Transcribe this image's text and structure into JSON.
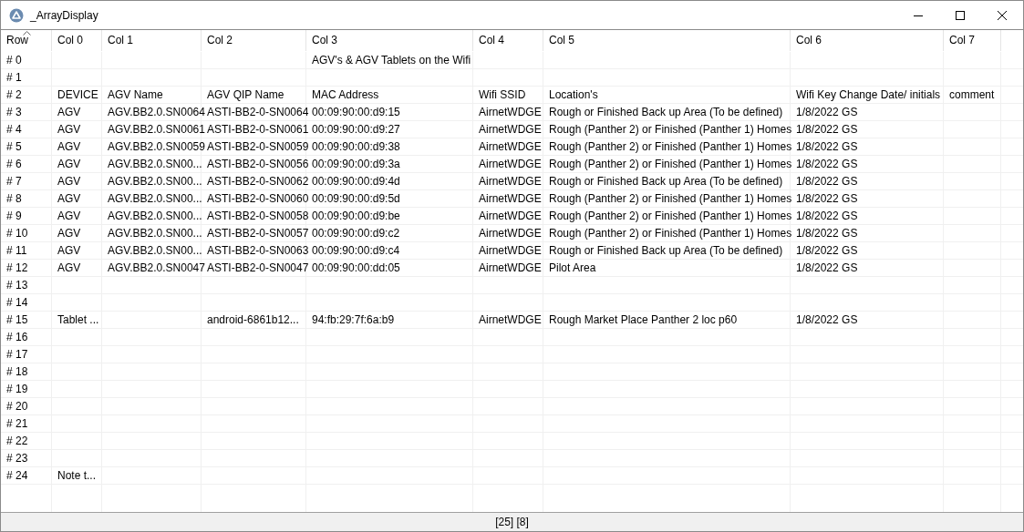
{
  "window": {
    "title": "_ArrayDisplay"
  },
  "table": {
    "row_header": "Row",
    "sorted_ascending": true,
    "columns": [
      "Col 0",
      "Col 1",
      "Col 2",
      "Col 3",
      "Col 4",
      "Col 5",
      "Col 6",
      "Col 7"
    ],
    "rows": [
      {
        "label": "# 0",
        "cells": {
          "col_3": "AGV's & AGV Tablets on the Wifi"
        }
      },
      {
        "label": "# 1",
        "cells": {}
      },
      {
        "label": "# 2",
        "cells": {
          "col_0": "DEVICE",
          "col_1": "AGV Name",
          "col_2": "AGV QIP Name",
          "col_3": "MAC Address",
          "col_4": "Wifi SSID",
          "col_5": "Location's",
          "col_6": "Wifi Key Change Date/ initials",
          "col_7": "comment"
        }
      },
      {
        "label": "# 3",
        "cells": {
          "col_0": "AGV",
          "col_1": "AGV.BB2.0.SN0064",
          "col_2": "ASTI-BB2-0-SN0064",
          "col_3": "00:09:90:00:d9:15",
          "col_4": "AirnetWDGE",
          "col_5": "Rough or Finished Back up Area (To be defined)",
          "col_6": "1/8/2022 GS"
        }
      },
      {
        "label": "# 4",
        "cells": {
          "col_0": "AGV",
          "col_1": "AGV.BB2.0.SN0061",
          "col_2": "ASTI-BB2-0-SN0061",
          "col_3": "00:09:90:00:d9:27",
          "col_4": "AirnetWDGE",
          "col_5": "Rough (Panther 2) or Finished (Panther 1) Homes",
          "col_6": "1/8/2022 GS"
        }
      },
      {
        "label": "# 5",
        "cells": {
          "col_0": "AGV",
          "col_1": "AGV.BB2.0.SN0059",
          "col_2": "ASTI-BB2-0-SN0059",
          "col_3": "00:09:90:00:d9:38",
          "col_4": "AirnetWDGE",
          "col_5": "Rough (Panther 2) or Finished (Panther 1) Homes",
          "col_6": "1/8/2022 GS"
        }
      },
      {
        "label": "# 6",
        "cells": {
          "col_0": "AGV",
          "col_1": "AGV.BB2.0.SN00...",
          "col_2": "ASTI-BB2-0-SN0056",
          "col_3": "00:09:90:00:d9:3a",
          "col_4": "AirnetWDGE",
          "col_5": "Rough (Panther 2) or Finished (Panther 1) Homes",
          "col_6": "1/8/2022 GS"
        }
      },
      {
        "label": "# 7",
        "cells": {
          "col_0": "AGV",
          "col_1": "AGV.BB2.0.SN00...",
          "col_2": "ASTI-BB2-0-SN0062",
          "col_3": "00:09:90:00:d9:4d",
          "col_4": "AirnetWDGE",
          "col_5": "Rough or Finished Back up Area (To be defined)",
          "col_6": "1/8/2022 GS"
        }
      },
      {
        "label": "# 8",
        "cells": {
          "col_0": "AGV",
          "col_1": "AGV.BB2.0.SN00...",
          "col_2": "ASTI-BB2-0-SN0060",
          "col_3": "00:09:90:00:d9:5d",
          "col_4": "AirnetWDGE",
          "col_5": "Rough (Panther 2) or Finished (Panther 1) Homes",
          "col_6": "1/8/2022 GS"
        }
      },
      {
        "label": "# 9",
        "cells": {
          "col_0": "AGV",
          "col_1": "AGV.BB2.0.SN00...",
          "col_2": "ASTI-BB2-0-SN0058",
          "col_3": "00:09:90:00:d9:be",
          "col_4": "AirnetWDGE",
          "col_5": "Rough (Panther 2) or Finished (Panther 1) Homes",
          "col_6": "1/8/2022 GS"
        }
      },
      {
        "label": "# 10",
        "cells": {
          "col_0": "AGV",
          "col_1": "AGV.BB2.0.SN00...",
          "col_2": "ASTI-BB2-0-SN0057",
          "col_3": "00:09:90:00:d9:c2",
          "col_4": "AirnetWDGE",
          "col_5": "Rough (Panther 2) or Finished (Panther 1) Homes",
          "col_6": "1/8/2022 GS"
        }
      },
      {
        "label": "# 11",
        "cells": {
          "col_0": "AGV",
          "col_1": "AGV.BB2.0.SN00...",
          "col_2": "ASTI-BB2-0-SN0063",
          "col_3": "00:09:90:00:d9:c4",
          "col_4": "AirnetWDGE",
          "col_5": "Rough or Finished Back up Area (To be defined)",
          "col_6": "1/8/2022 GS"
        }
      },
      {
        "label": "# 12",
        "cells": {
          "col_0": "AGV",
          "col_1": "AGV.BB2.0.SN0047",
          "col_2": "ASTI-BB2-0-SN0047",
          "col_3": "00:09:90:00:dd:05",
          "col_4": "AirnetWDGE",
          "col_5": "Pilot Area",
          "col_6": "1/8/2022 GS"
        }
      },
      {
        "label": "# 13",
        "cells": {}
      },
      {
        "label": "# 14",
        "cells": {}
      },
      {
        "label": "# 15",
        "cells": {
          "col_0": "Tablet ...",
          "col_2": "android-6861b12...",
          "col_3": "94:fb:29:7f:6a:b9",
          "col_4": "AirnetWDGE",
          "col_5": "Rough Market Place Panther 2 loc p60",
          "col_6": "1/8/2022 GS"
        }
      },
      {
        "label": "# 16",
        "cells": {}
      },
      {
        "label": "# 17",
        "cells": {}
      },
      {
        "label": "# 18",
        "cells": {}
      },
      {
        "label": "# 19",
        "cells": {}
      },
      {
        "label": "# 20",
        "cells": {}
      },
      {
        "label": "# 21",
        "cells": {}
      },
      {
        "label": "# 22",
        "cells": {}
      },
      {
        "label": "# 23",
        "cells": {}
      },
      {
        "label": "# 24",
        "cells": {
          "col_0": "Note t..."
        }
      }
    ]
  },
  "status_bar": {
    "text": "[25] [8]"
  }
}
